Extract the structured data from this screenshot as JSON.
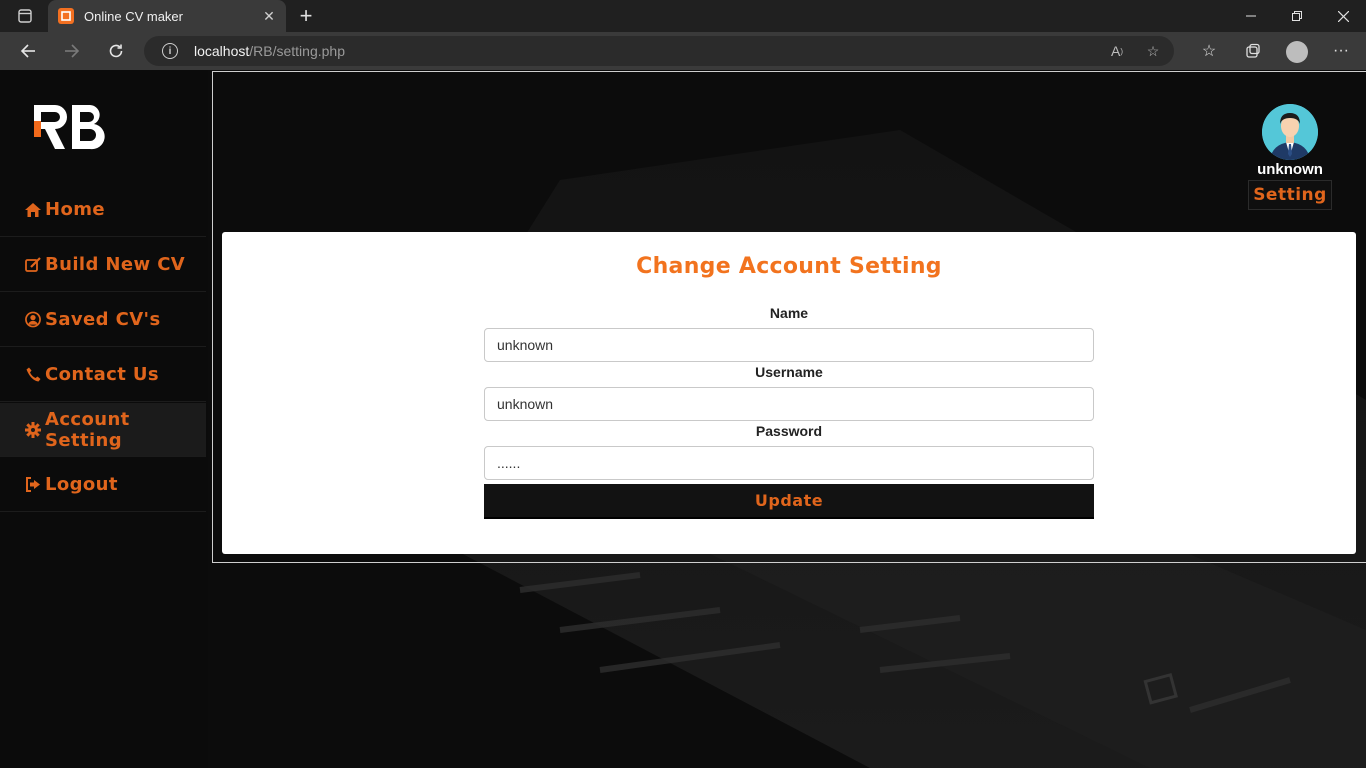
{
  "browser": {
    "tab_title": "Online CV maker",
    "url_host": "localhost",
    "url_path": "/RB/setting.php"
  },
  "sidebar": {
    "logo_text": "RB",
    "items": [
      {
        "label": "Home",
        "icon": "home-icon"
      },
      {
        "label": "Build New CV",
        "icon": "edit-icon"
      },
      {
        "label": "Saved CV's",
        "icon": "user-circle-icon"
      },
      {
        "label": "Contact Us",
        "icon": "phone-icon"
      },
      {
        "label": "Account Setting",
        "icon": "gear-icon",
        "active": true
      },
      {
        "label": "Logout",
        "icon": "sign-out-icon"
      }
    ]
  },
  "header": {
    "user_name": "unknown",
    "setting_label": "Setting"
  },
  "form": {
    "title": "Change Account Setting",
    "name_label": "Name",
    "name_value": "unknown",
    "username_label": "Username",
    "username_value": "unknown",
    "password_label": "Password",
    "password_value": "......",
    "update_label": "Update"
  },
  "colors": {
    "accent": "#e0651c",
    "title": "#f2731e",
    "background": "#0a0a0a"
  }
}
